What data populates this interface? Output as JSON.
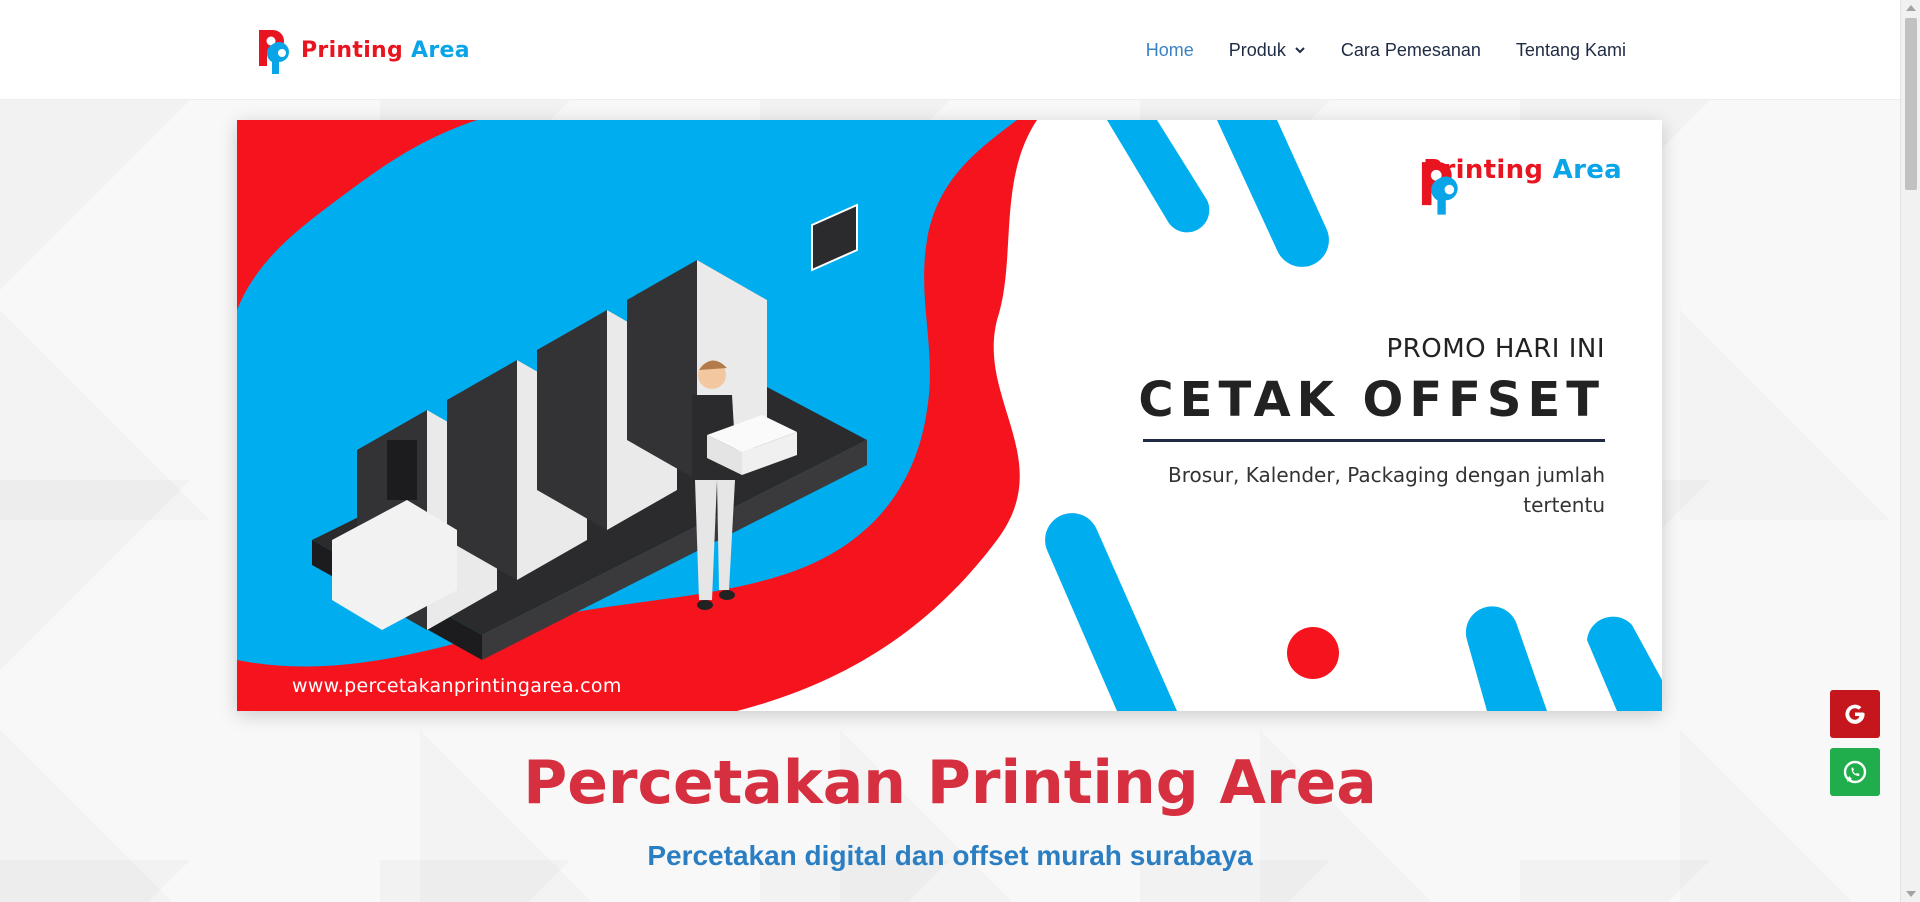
{
  "header": {
    "logo": {
      "word1": "Printing",
      "word2": "Area"
    },
    "nav": [
      {
        "label": "Home",
        "active": true
      },
      {
        "label": "Produk",
        "has_dropdown": true
      },
      {
        "label": "Cara Pemesanan"
      },
      {
        "label": "Tentang Kami"
      }
    ]
  },
  "banner": {
    "logo": {
      "word1": "Printing",
      "word2": "Area"
    },
    "promo_sub": "PROMO HARI INI",
    "promo_title": "CETAK OFFSET",
    "promo_desc_line1": "Brosur, Kalender, Packaging dengan jumlah",
    "promo_desc_line2": "tertentu",
    "url": "www.percetakanprintingarea.com",
    "colors": {
      "red": "#f5141e",
      "blue": "#00adef"
    }
  },
  "main": {
    "title": "Percetakan Printing Area",
    "subtitle": "Percetakan digital dan offset murah surabaya"
  },
  "floating": {
    "google_icon": "google-icon",
    "whatsapp_icon": "whatsapp-icon"
  }
}
